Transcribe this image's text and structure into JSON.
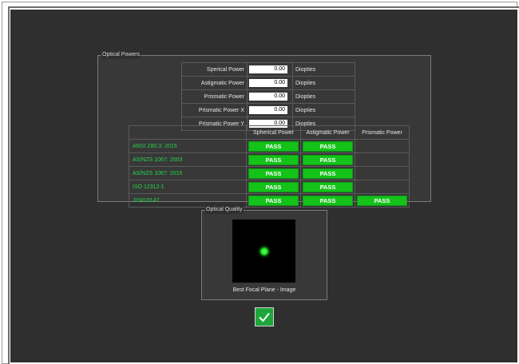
{
  "optical_powers": {
    "title": "Optical Powers",
    "rows": [
      {
        "label": "Sperical Power",
        "value": "0.00",
        "unit": "Diopties"
      },
      {
        "label": "Astigmatic Power",
        "value": "0.00",
        "unit": "Diopties"
      },
      {
        "label": "Prismatic Power",
        "value": "0.00",
        "unit": "Diopties"
      },
      {
        "label": "Prismatic Power X",
        "value": "0.00",
        "unit": "Diopties"
      },
      {
        "label": "Prismatic Power Y",
        "value": "0.00",
        "unit": "Diopties"
      }
    ],
    "standards": {
      "headers": [
        "",
        "Spherical Power",
        "Astigmatic Power",
        "Prismatic Power"
      ],
      "rows": [
        {
          "name": "ANSI Z80.3: 2015",
          "spherical": "PASS",
          "astigmatic": "PASS",
          "prismatic": ""
        },
        {
          "name": "AS/NZS 1067: 2003",
          "spherical": "PASS",
          "astigmatic": "PASS",
          "prismatic": ""
        },
        {
          "name": "AS/NZS 1067: 2016",
          "spherical": "PASS",
          "astigmatic": "PASS",
          "prismatic": ""
        },
        {
          "name": "ISO 12312-1",
          "spherical": "PASS",
          "astigmatic": "PASS",
          "prismatic": ""
        },
        {
          "name": "JIS#18147",
          "spherical": "PASS",
          "astigmatic": "PASS",
          "prismatic": "PASS"
        }
      ]
    }
  },
  "optical_quality": {
    "title": "Optical Quality",
    "caption": "Best Focal Plane - Image"
  },
  "colors": {
    "background": "#2f2f2f",
    "pass_green": "#14c21a",
    "standard_text": "#22d64a",
    "ok_button": "#1fa63a"
  },
  "ok_button": {
    "icon": "checkmark-icon"
  }
}
